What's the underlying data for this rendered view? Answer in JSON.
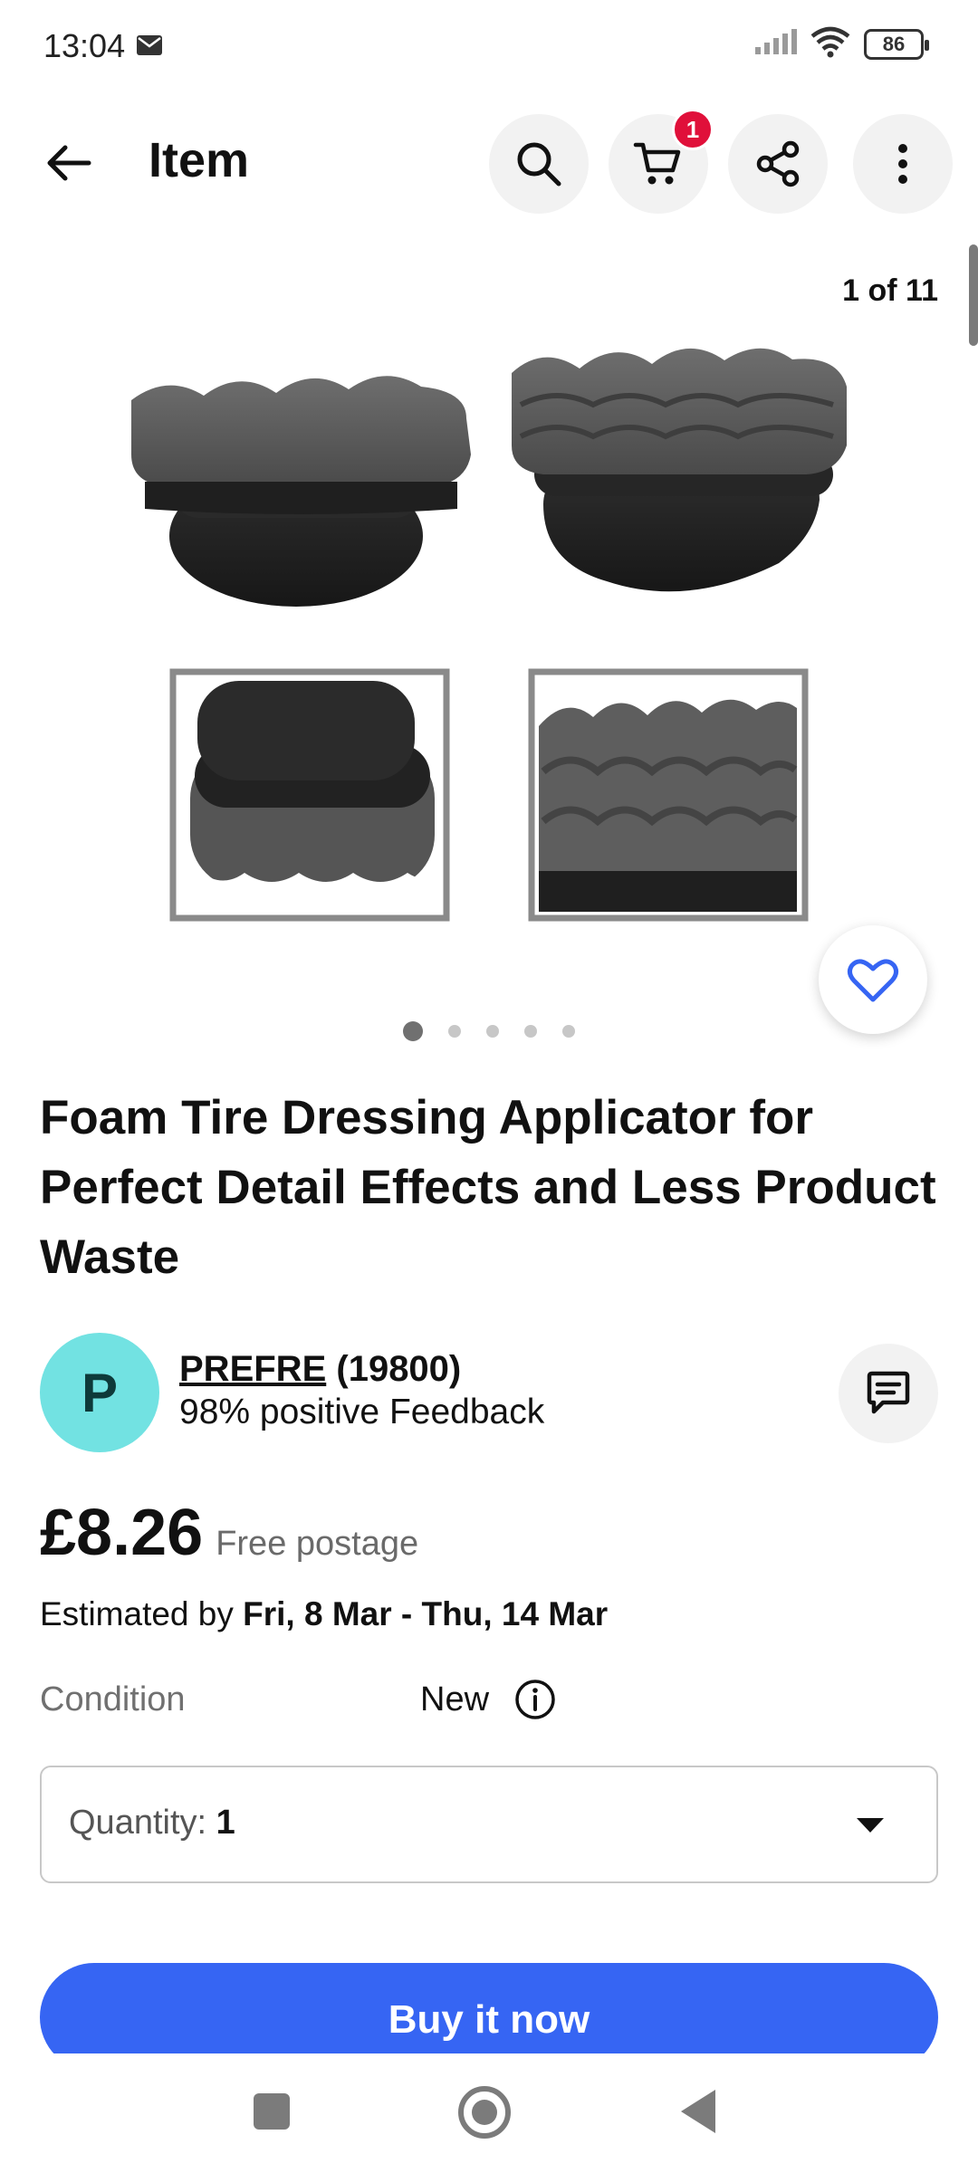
{
  "status_bar": {
    "time": "13:04",
    "battery": "86"
  },
  "header": {
    "title": "Item",
    "cart_count": "1"
  },
  "gallery": {
    "counter": "1 of 11",
    "active_dot": 1,
    "dot_count": 5
  },
  "product": {
    "title": "Foam Tire Dressing Applicator for Perfect Detail Effects and Less Product Waste"
  },
  "seller": {
    "initial": "P",
    "name": "PREFRE",
    "rating_count": "(19800)",
    "feedback": "98% positive Feedback"
  },
  "price": {
    "amount": "£8.26",
    "postage": "Free postage"
  },
  "delivery": {
    "prefix": "Estimated by",
    "range": "Fri, 8 Mar - Thu, 14 Mar"
  },
  "condition": {
    "label": "Condition",
    "value": "New"
  },
  "quantity": {
    "label": "Quantity:",
    "value": "1"
  },
  "actions": {
    "buy_now": "Buy it now"
  },
  "colors": {
    "accent": "#3665f3",
    "badge": "#e0103a",
    "avatar": "#72e2e2"
  },
  "icons": [
    "mail-icon",
    "signal-icon",
    "wifi-icon",
    "battery-icon",
    "back-arrow-icon",
    "search-icon",
    "cart-icon",
    "share-icon",
    "more-icon",
    "heart-icon",
    "message-icon",
    "info-icon",
    "chevron-down-icon"
  ]
}
